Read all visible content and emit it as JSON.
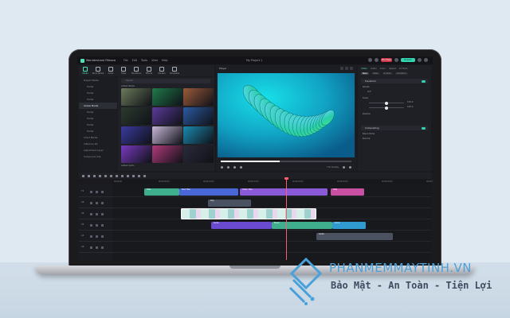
{
  "app": {
    "name": "Wondershare Filmora",
    "doc_title": "My Project 1",
    "menu": [
      "File",
      "Edit",
      "Tools",
      "View",
      "Help"
    ],
    "buttons": {
      "upgrade": "Purchase",
      "export": "Export"
    }
  },
  "media_toolbar": {
    "items": [
      {
        "label": "Media",
        "icon": "media-icon",
        "active": true
      },
      {
        "label": "Stock Media",
        "icon": "stock-icon",
        "active": false
      },
      {
        "label": "Audio",
        "icon": "audio-icon",
        "active": false
      },
      {
        "label": "Titles",
        "icon": "titles-icon",
        "active": false
      },
      {
        "label": "Transitions",
        "icon": "transitions-icon",
        "active": false
      },
      {
        "label": "Effects",
        "icon": "effects-icon",
        "active": false
      },
      {
        "label": "Stickers",
        "icon": "stickers-icon",
        "active": false
      },
      {
        "label": "Templates",
        "icon": "templates-icon",
        "active": false
      }
    ]
  },
  "sidebar": {
    "items": [
      {
        "label": "Project Media",
        "sub": false,
        "selected": false
      },
      {
        "label": "Folder",
        "sub": true,
        "selected": false
      },
      {
        "label": "Folder",
        "sub": true,
        "selected": false
      },
      {
        "label": "Folder",
        "sub": true,
        "selected": false
      },
      {
        "label": "Global Media",
        "sub": false,
        "selected": true
      },
      {
        "label": "Folder",
        "sub": true,
        "selected": false
      },
      {
        "label": "Folder",
        "sub": true,
        "selected": false
      },
      {
        "label": "Folder",
        "sub": true,
        "selected": false
      },
      {
        "label": "Folder",
        "sub": true,
        "selected": false
      },
      {
        "label": "Cloud Media",
        "sub": false,
        "selected": false
      },
      {
        "label": "Influence Kit",
        "sub": false,
        "selected": false
      },
      {
        "label": "Adjustment Layer",
        "sub": false,
        "selected": false
      },
      {
        "label": "Compound Clip",
        "sub": false,
        "selected": false
      }
    ]
  },
  "media": {
    "search_placeholder": "Search",
    "section1": "Added Media",
    "section2": "Stock Video",
    "section3": "Added Audio",
    "thumbs": [
      "#6b7a5a",
      "#1f7a4a",
      "#9b5a3a",
      "#2c3a2e",
      "#5a3a9a",
      "#2a5aa0",
      "#3a3aa0",
      "#c8b8d8",
      "#1a8ab0",
      "#7a3ac0",
      "#b03a7a",
      "#2a2a3a"
    ]
  },
  "preview": {
    "title": "Player",
    "progress": 0.45,
    "quality": "Full Quality"
  },
  "properties": {
    "tabs": [
      {
        "label": "Video",
        "active": true
      },
      {
        "label": "Audio",
        "active": false
      },
      {
        "label": "Color",
        "active": false
      },
      {
        "label": "Speed",
        "active": false
      },
      {
        "label": "AI Tools",
        "active": false
      }
    ],
    "subtabs": [
      {
        "label": "Basic",
        "active": true
      },
      {
        "label": "Mask",
        "active": false
      },
      {
        "label": "AI Tools",
        "active": false
      },
      {
        "label": "Animation",
        "active": false
      }
    ],
    "section_transform": "Transform",
    "rotate_label": "Rotate",
    "rotate_value": "0.0°",
    "scale_label": "Scale",
    "scale_x": "100.0",
    "scale_y": "100.0",
    "position_label": "Position",
    "section_compositing": "Compositing",
    "blend_label": "Blend Mode",
    "blend_value": "Normal"
  },
  "timeline": {
    "ruler": [
      "00:00:00",
      "00:00:05:00",
      "00:00:10:00",
      "00:00:15:00",
      "00:00:20:00",
      "00:00:25:00",
      "00:00:30:00",
      "00:00:35:00"
    ],
    "tracks": [
      "T1",
      "V3",
      "V2",
      "V1",
      "A1",
      "A2"
    ],
    "clips": [
      {
        "track": 0,
        "start": 40,
        "end": 84,
        "color": "#3fae8c",
        "label": "Title"
      },
      {
        "track": 0,
        "start": 84,
        "end": 158,
        "color": "#4a67d8",
        "label": "Text Title"
      },
      {
        "track": 0,
        "start": 160,
        "end": 270,
        "color": "#8a5ad8",
        "label": "Video Title"
      },
      {
        "track": 0,
        "start": 274,
        "end": 316,
        "color": "#c94fa3",
        "label": "Title"
      },
      {
        "track": 1,
        "start": 120,
        "end": 174,
        "color": "#4a5160",
        "label": "Clip"
      },
      {
        "track": 2,
        "start": 86,
        "end": 256,
        "color": "#bfe3e0",
        "label": ""
      },
      {
        "track": 3,
        "start": 124,
        "end": 200,
        "color": "#6a4ad0",
        "label": "Audio"
      },
      {
        "track": 3,
        "start": 200,
        "end": 276,
        "color": "#3fae8c",
        "label": "Music"
      },
      {
        "track": 3,
        "start": 276,
        "end": 318,
        "color": "#2f9bd0",
        "label": "Voice"
      },
      {
        "track": 4,
        "start": 256,
        "end": 352,
        "color": "#4a5160",
        "label": "Audio"
      }
    ],
    "playhead": 0.545
  },
  "watermark": {
    "title": "PHANMEMMAYTINH.VN",
    "slogan": "Bảo Mật - An Toàn - Tiện Lợi",
    "brand_color": "#4aa0d8"
  }
}
